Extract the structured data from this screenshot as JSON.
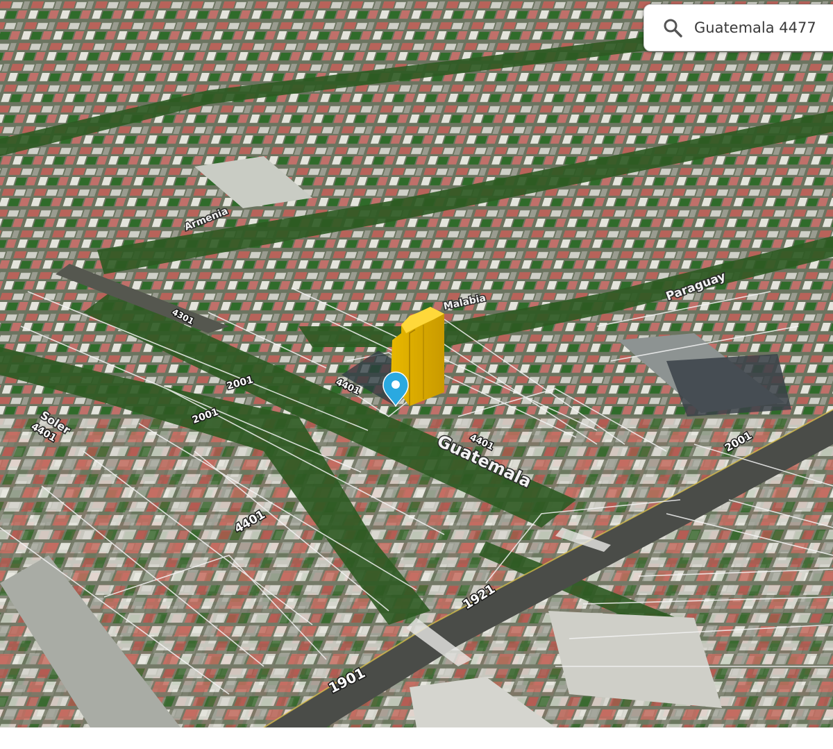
{
  "search": {
    "query": "Guatemala 4477",
    "icon": "search-icon"
  },
  "map": {
    "view": "3d-satellite",
    "pin_color": "#2aa9e0",
    "building_color": "#f2c500",
    "streets": [
      {
        "id": "guatemala",
        "name": "Guatemala"
      },
      {
        "id": "paraguay",
        "name": "Paraguay"
      },
      {
        "id": "soler",
        "name": "Soler"
      },
      {
        "id": "armenia",
        "name": "Armenia"
      },
      {
        "id": "malabia",
        "name": "Malabia"
      }
    ],
    "house_numbers": [
      {
        "id": "n4401-center",
        "value": "4401"
      },
      {
        "id": "n4401-road",
        "value": "4401"
      },
      {
        "id": "n4401-left",
        "value": "4401"
      },
      {
        "id": "n4401-bottom",
        "value": "4401"
      },
      {
        "id": "n2001-left",
        "value": "2001"
      },
      {
        "id": "n2001-mid",
        "value": "2001"
      },
      {
        "id": "n2001-right",
        "value": "2001"
      },
      {
        "id": "n1921",
        "value": "1921"
      },
      {
        "id": "n1901",
        "value": "1901"
      },
      {
        "id": "n4301",
        "value": "4301"
      }
    ]
  }
}
